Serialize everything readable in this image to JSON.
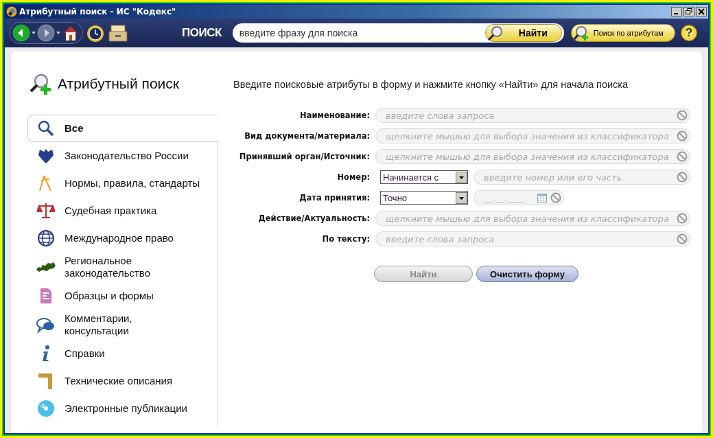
{
  "window": {
    "title": "Атрибутный поиск - ИС \"Кодекс\""
  },
  "toolbar": {
    "search_label": "ПОИСК",
    "search_field": {
      "placeholder": "введите фразу для поиска"
    },
    "find_button": "Найти",
    "attribute_search_button": "Поиск по атрибутам",
    "help_button": "?"
  },
  "sidebar": {
    "title": "Атрибутный поиск",
    "items": [
      {
        "label": "Все",
        "selected": true
      },
      {
        "label": "Законодательство России",
        "selected": false
      },
      {
        "label": "Нормы, правила, стандарты",
        "selected": false
      },
      {
        "label": "Судебная практика",
        "selected": false
      },
      {
        "label": "Международное право",
        "selected": false
      },
      {
        "label": "Региональное законодательство",
        "selected": false
      },
      {
        "label": "Образцы и формы",
        "selected": false
      },
      {
        "label": "Комментарии, консультации",
        "selected": false
      },
      {
        "label": "Справки",
        "selected": false
      },
      {
        "label": "Технические описания",
        "selected": false
      },
      {
        "label": "Электронные публикации",
        "selected": false
      }
    ]
  },
  "form": {
    "instruction": "Введите поисковые атрибуты в форму и нажмите кнопку «Найти» для начала поиска",
    "fields": [
      {
        "kind": "text",
        "label": "Наименование:",
        "placeholder": "введите слова запроса"
      },
      {
        "kind": "text",
        "label": "Вид документа/материала:",
        "placeholder": "щелкните мышью для выбора значения из классификатора"
      },
      {
        "kind": "text",
        "label": "Принявший орган/Источник:",
        "placeholder": "щелкните мышью для выбора значения из классификатора"
      },
      {
        "kind": "select_text",
        "label": "Номер:",
        "select": "Начинается с",
        "placeholder": "введите номер или его часть"
      },
      {
        "kind": "date",
        "label": "Дата принятия:",
        "select": "Точно",
        "placeholder": "__.__.____"
      },
      {
        "kind": "text",
        "label": "Действие/Актуальность:",
        "placeholder": "щелкните мышью для выбора значения из классификатора"
      },
      {
        "kind": "text",
        "label": "По тексту:",
        "placeholder": "введите слова запроса"
      }
    ],
    "buttons": [
      {
        "label": "Найти",
        "disabled": true
      },
      {
        "label": "Очистить форму",
        "disabled": false
      }
    ]
  }
}
